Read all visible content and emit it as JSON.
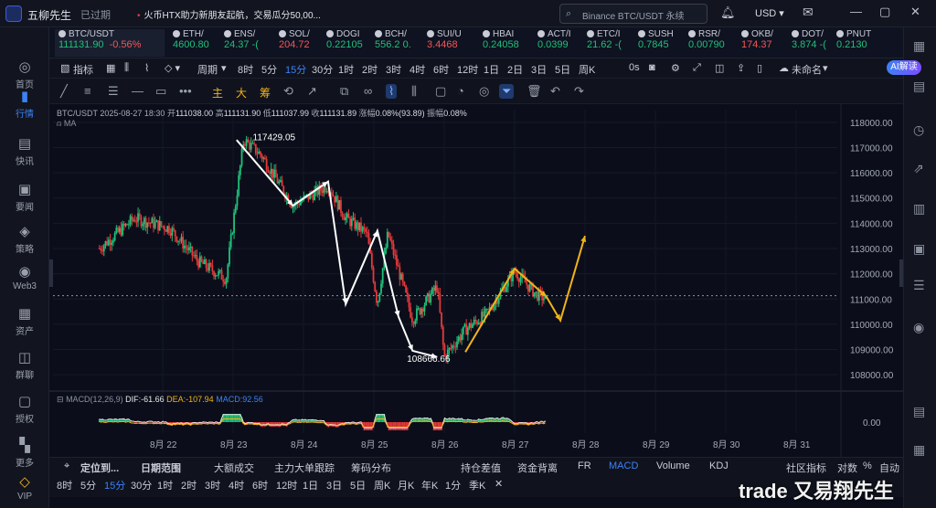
{
  "titlebar": {
    "app_name": "五柳先生",
    "expired": "已过期",
    "news": "火币HTX助力新朋友起航，交易瓜分50,00...",
    "search_placeholder": "Binance BTC/USDT 永续",
    "currency": "USD ▾"
  },
  "leftnav": [
    {
      "icon": "home-icon",
      "label": "首页"
    },
    {
      "icon": "market-icon",
      "label": "行情"
    },
    {
      "icon": "flash-news-icon",
      "label": "快讯"
    },
    {
      "icon": "news-icon",
      "label": "要闻"
    },
    {
      "icon": "strategy-icon",
      "label": "策略"
    },
    {
      "icon": "web3-icon",
      "label": "Web3"
    },
    {
      "icon": "assets-icon",
      "label": "资产"
    },
    {
      "icon": "group-chat-icon",
      "label": "群聊"
    },
    {
      "icon": "authorize-icon",
      "label": "授权"
    },
    {
      "icon": "more-icon",
      "label": "更多"
    },
    {
      "icon": "vip-icon",
      "label": "VIP"
    }
  ],
  "ticker": [
    {
      "symbol": "BTC/USDT",
      "price": "111131.90",
      "change": "-0.56%",
      "active": true
    },
    {
      "symbol": "ETH/",
      "price": "4600.80"
    },
    {
      "symbol": "ENS/",
      "price": "24.37 -("
    },
    {
      "symbol": "SOL/",
      "price": "204.72"
    },
    {
      "symbol": "DOGI",
      "price": "0.22105"
    },
    {
      "symbol": "BCH/",
      "price": "556.2 0."
    },
    {
      "symbol": "SUI/U",
      "price": "3.4468"
    },
    {
      "symbol": "HBAI",
      "price": "0.24058"
    },
    {
      "symbol": "ACT/I",
      "price": "0.0399"
    },
    {
      "symbol": "ETC/I",
      "price": "21.62 -("
    },
    {
      "symbol": "SUSH",
      "price": "0.7845"
    },
    {
      "symbol": "RSR/",
      "price": "0.00790"
    },
    {
      "symbol": "OKB/",
      "price": "174.37"
    },
    {
      "symbol": "DOT/",
      "price": "3.874 -("
    },
    {
      "symbol": "PNUT",
      "price": "0.2130"
    }
  ],
  "toolbar1": {
    "indicator": "指标",
    "period": "周期",
    "intervals": [
      "8时",
      "5分",
      "15分",
      "30分",
      "1时",
      "2时",
      "3时",
      "4时",
      "6时",
      "12时",
      "1日",
      "2日",
      "3日",
      "5日",
      "周K"
    ],
    "active_interval": "15分",
    "countdown": "0s",
    "layout_name": "未命名",
    "ai_button": "AI解读"
  },
  "toolbar2": {
    "draw_tools": [
      "trend-line-icon",
      "horizontal-lines-icon",
      "parallel-channel-icon",
      "ray-icon",
      "rectangle-icon",
      "more-dots-icon"
    ],
    "text_tools": [
      "主",
      "大",
      "筹"
    ]
  },
  "chart_info": {
    "pair": "BTC/USDT",
    "time": "2025-08-27 18:30",
    "open_label": "开",
    "open": "111038.00",
    "high_label": "高",
    "high": "111131.90",
    "low_label": "低",
    "low": "111037.99",
    "close_label": "收",
    "close": "111131.89",
    "change_label": "涨幅",
    "change": "0.08%(93.89)",
    "amp_label": "振幅",
    "amp": "0.08%",
    "ma_label": "MA"
  },
  "macd": {
    "label": "MACD(12,26,9)",
    "dif": "DIF:-61.66",
    "dea": "DEA:-107.94",
    "macd": "MACD:92.56",
    "zero_tick": "0.00"
  },
  "chart_data": {
    "type": "line",
    "title": "BTC/USDT 15分",
    "ylim": [
      107500,
      118500
    ],
    "y_ticks": [
      "118000.00",
      "117000.00",
      "116000.00",
      "115000.00",
      "114000.00",
      "113000.00",
      "112000.00",
      "111000.00",
      "110000.00",
      "109000.00",
      "108000.00"
    ],
    "x_ticks": [
      "8月 22",
      "8月 23",
      "8月 24",
      "8月 25",
      "8月 26",
      "8月 27",
      "8月 28",
      "8月 29",
      "8月 30",
      "8月 31"
    ],
    "current_price": 111131.9,
    "annotations": [
      {
        "text": "117429.05",
        "x": 1.15,
        "y": 117429.05
      },
      {
        "text": "108666.66",
        "x": 4.25,
        "y": 108666.66
      }
    ],
    "series": [
      {
        "color": "#ffffff",
        "x": [
          1.05,
          1.85,
          2.35,
          2.6,
          3.05,
          3.35,
          3.55,
          3.9
        ],
        "y": [
          117300,
          114700,
          115650,
          110800,
          113700,
          110300,
          108950,
          108700
        ]
      },
      {
        "color": "#f2b31b",
        "x": [
          4.3,
          5.0,
          5.45,
          5.65,
          6.0
        ],
        "y": [
          108900,
          112200,
          111100,
          110150,
          113500
        ]
      }
    ]
  },
  "bottom1": [
    "定位到...",
    "日期范围",
    "大额成交",
    "主力大单跟踪",
    "筹码分布",
    "持仓差值",
    "资金背离",
    "FR",
    "MACD",
    "Volume",
    "KDJ",
    "社区指标",
    "对数",
    "%",
    "自动"
  ],
  "bottom1_active": "MACD",
  "bottom2": [
    "8时",
    "5分",
    "15分",
    "30分",
    "1时",
    "2时",
    "3时",
    "4时",
    "6时",
    "12时",
    "1日",
    "3日",
    "5日",
    "周K",
    "月K",
    "年K",
    "1分",
    "季K"
  ],
  "bottom2_active": "15分",
  "watermark": "trade 又易翔先生"
}
